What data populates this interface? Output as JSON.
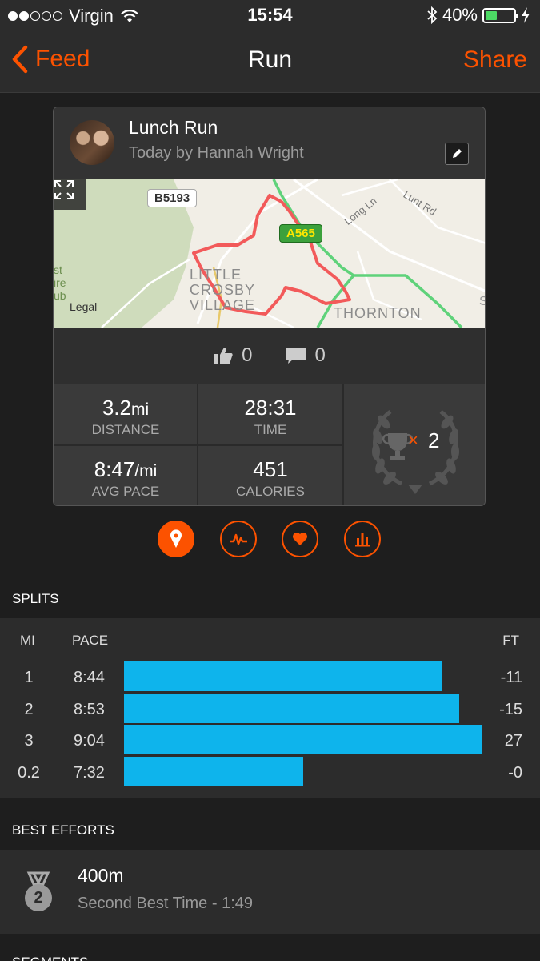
{
  "status_bar": {
    "carrier": "Virgin",
    "time": "15:54",
    "battery": "40%",
    "battery_level": 0.4
  },
  "nav": {
    "back_label": "Feed",
    "title": "Run",
    "share_label": "Share"
  },
  "activity": {
    "name": "Lunch Run",
    "subtitle": "Today by Hannah Wright",
    "map": {
      "labels": {
        "legal": "Legal",
        "road_b": "B5193",
        "road_a": "A565",
        "place1": "LITTLE\nCROSBY\nVILLAGE",
        "place2": "THORNTON",
        "long_ln": "Long Ln",
        "lunt_rd": "Lunt Rd",
        "cutoff_text": "st\nire\nub",
        "s_cut": "S"
      }
    },
    "kudos": "0",
    "comments": "0",
    "stats": {
      "distance_value": "3.2",
      "distance_unit": "mi",
      "distance_label": "DISTANCE",
      "time_value": "28:31",
      "time_label": "TIME",
      "pace_value": "8:47",
      "pace_unit": "/mi",
      "pace_label": "AVG PACE",
      "calories_value": "451",
      "calories_label": "CALORIES"
    },
    "achievements": {
      "multiplier": "×",
      "count": "2"
    }
  },
  "tabs": [
    {
      "name": "map",
      "active": true
    },
    {
      "name": "pace-chart",
      "active": false
    },
    {
      "name": "heart-rate",
      "active": false
    },
    {
      "name": "analysis",
      "active": false
    }
  ],
  "splits": {
    "title": "SPLITS",
    "headers": {
      "mi": "MI",
      "pace": "PACE",
      "ft": "FT"
    },
    "rows": [
      {
        "mi": "1",
        "pace": "8:44",
        "ft": "-11",
        "bar": 0.888
      },
      {
        "mi": "2",
        "pace": "8:53",
        "ft": "-15",
        "bar": 0.935
      },
      {
        "mi": "3",
        "pace": "9:04",
        "ft": "27",
        "bar": 1.0
      },
      {
        "mi": "0.2",
        "pace": "7:32",
        "ft": "-0",
        "bar": 0.5
      }
    ]
  },
  "best_efforts": {
    "title": "BEST EFFORTS",
    "items": [
      {
        "name": "400m",
        "desc": "Second Best Time - 1:49",
        "rank": "2"
      }
    ]
  },
  "segments": {
    "title": "SEGMENTS"
  },
  "colors": {
    "accent": "#fc5200",
    "bar": "#0eb4ec",
    "route": "#f25a5a",
    "bg": "#1e1e1e"
  }
}
